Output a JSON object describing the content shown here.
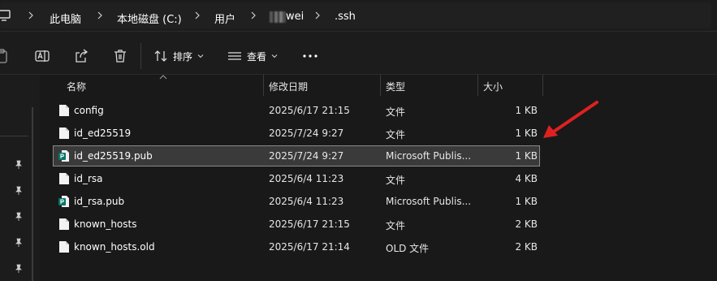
{
  "breadcrumbs": [
    "此电脑",
    "本地磁盘 (C:)",
    "用户",
    "wei",
    ".ssh"
  ],
  "toolbar": {
    "sort_label": "排序",
    "view_label": "查看"
  },
  "columns": {
    "name": "名称",
    "modified": "修改日期",
    "type": "类型",
    "size": "大小"
  },
  "files": [
    {
      "name": "config",
      "modified": "2025/6/17 21:15",
      "type": "文件",
      "size": "1 KB",
      "icon": "blank-file-icon"
    },
    {
      "name": "id_ed25519",
      "modified": "2025/7/24 9:27",
      "type": "文件",
      "size": "1 KB",
      "icon": "blank-file-icon"
    },
    {
      "name": "id_ed25519.pub",
      "modified": "2025/7/24 9:27",
      "type": "Microsoft Publis...",
      "size": "1 KB",
      "icon": "publisher-file-icon",
      "selected": true
    },
    {
      "name": "id_rsa",
      "modified": "2025/6/4 11:23",
      "type": "文件",
      "size": "4 KB",
      "icon": "blank-file-icon"
    },
    {
      "name": "id_rsa.pub",
      "modified": "2025/6/4 11:23",
      "type": "Microsoft Publis...",
      "size": "1 KB",
      "icon": "publisher-file-icon"
    },
    {
      "name": "known_hosts",
      "modified": "2025/6/17 21:15",
      "type": "文件",
      "size": "2 KB",
      "icon": "blank-file-icon"
    },
    {
      "name": "known_hosts.old",
      "modified": "2025/6/17 21:14",
      "type": "OLD 文件",
      "size": "2 KB",
      "icon": "blank-file-icon"
    }
  ],
  "colors": {
    "background": "#191919",
    "selection": "#3a3a3a",
    "annotation_arrow": "#e02020",
    "publisher_icon": "#077568"
  }
}
